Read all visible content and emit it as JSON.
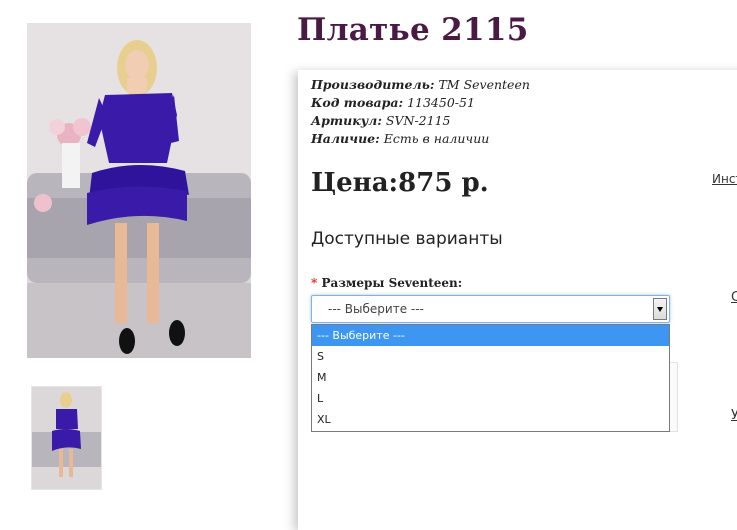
{
  "product": {
    "title": "Платье 2115",
    "manufacturer_label": "Производитель:",
    "manufacturer_value": "TM Seventeen",
    "code_label": "Код товара:",
    "code_value": "113450-51",
    "sku_label": "Артикул:",
    "sku_value": "SVN-2115",
    "availability_label": "Наличие:",
    "availability_value": "Есть в наличии",
    "price": "Цена:875 р.",
    "right_link": "Инст"
  },
  "variants": {
    "heading": "Доступные варианты",
    "required_mark": "*",
    "size_label": "Размеры Seventeen:",
    "selected": "--- Выберите ---",
    "options": [
      "--- Выберите ---",
      "S",
      "M",
      "L",
      "XL"
    ]
  },
  "edge_glyphs": [
    "С",
    "У"
  ],
  "colors": {
    "title": "#4b1a44",
    "dress": "#3a1aa8",
    "highlight": "#3d97f2",
    "required": "#e0281e"
  }
}
